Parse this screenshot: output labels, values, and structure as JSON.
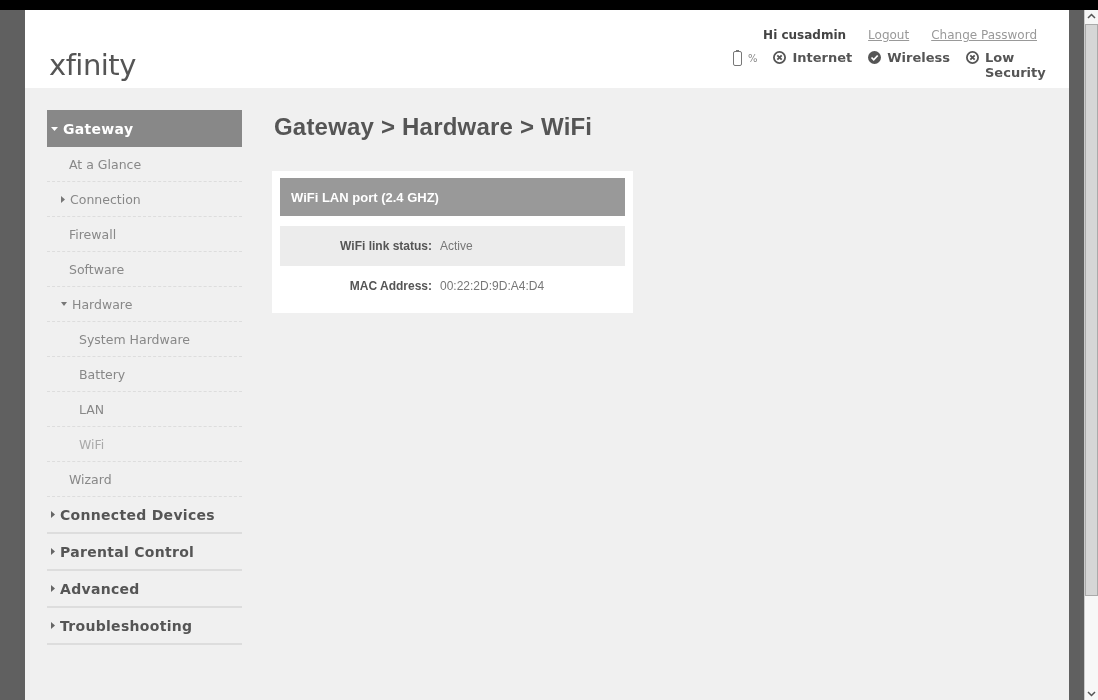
{
  "logo": "xfinity",
  "header": {
    "greeting": "Hi cusadmin",
    "links": [
      "Logout",
      "Change Password"
    ],
    "battery": {
      "text": "%"
    },
    "statuses": [
      {
        "label": "Internet",
        "ok": false
      },
      {
        "label": "Wireless",
        "ok": true
      },
      {
        "label": "Low Security",
        "ok": false
      }
    ]
  },
  "sidebar": {
    "items": [
      {
        "label": "Gateway",
        "expanded": true,
        "selected": true,
        "children": [
          {
            "label": "At a Glance",
            "selected": false
          },
          {
            "label": "Connection",
            "expanded": false,
            "selected": false
          },
          {
            "label": "Firewall",
            "selected": false
          },
          {
            "label": "Software",
            "selected": false
          },
          {
            "label": "Hardware",
            "expanded": true,
            "selected": false,
            "children": [
              {
                "label": "System Hardware",
                "selected": false
              },
              {
                "label": "Battery",
                "selected": false
              },
              {
                "label": "LAN",
                "selected": false
              },
              {
                "label": "WiFi",
                "selected": true
              }
            ]
          },
          {
            "label": "Wizard",
            "selected": false
          }
        ]
      },
      {
        "label": "Connected Devices",
        "expanded": false,
        "selected": false
      },
      {
        "label": "Parental Control",
        "expanded": false,
        "selected": false
      },
      {
        "label": "Advanced",
        "expanded": false,
        "selected": false
      },
      {
        "label": "Troubleshooting",
        "expanded": false,
        "selected": false
      }
    ]
  },
  "page_title": "Gateway > Hardware > WiFi",
  "card": {
    "title": "WiFi LAN port (2.4 GHZ)",
    "rows": [
      {
        "label": "WiFi link status:",
        "value": "Active"
      },
      {
        "label": "MAC Address:",
        "value": "00:22:2D:9D:A4:D4"
      }
    ]
  }
}
